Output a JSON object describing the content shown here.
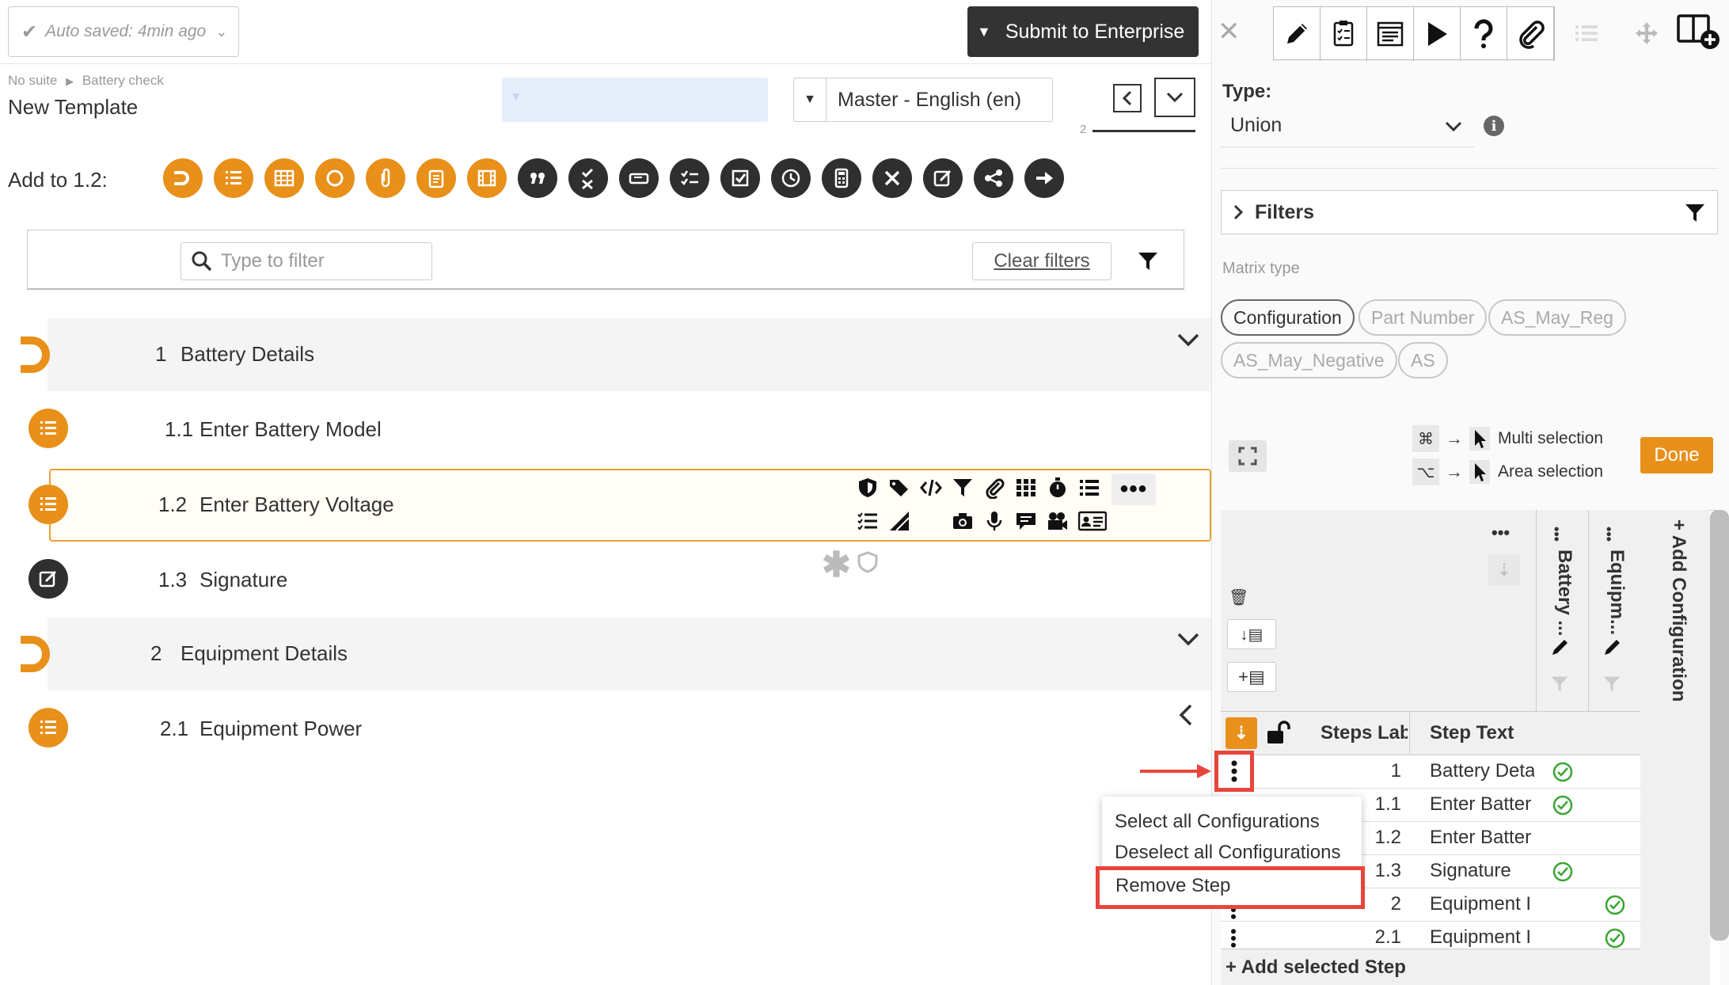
{
  "header": {
    "autosave": "Auto saved: 4min ago",
    "submit": "Submit to Enterprise",
    "breadcrumb_suite": "No suite",
    "breadcrumb_sep": "▶",
    "breadcrumb_item": "Battery check",
    "template_title": "New Template",
    "language": "Master - English (en)",
    "page_counter": "2"
  },
  "add_bar": {
    "label": "Add to 1.2:"
  },
  "filter": {
    "placeholder": "Type to filter",
    "clear": "Clear filters"
  },
  "steps": [
    {
      "num": "1",
      "label": "Battery Details"
    },
    {
      "num": "1.1",
      "label": "Enter Battery Model"
    },
    {
      "num": "1.2",
      "label": "Enter Battery Voltage"
    },
    {
      "num": "1.3",
      "label": "Signature"
    },
    {
      "num": "2",
      "label": "Equipment Details"
    },
    {
      "num": "2.1",
      "label": "Equipment Power"
    }
  ],
  "right": {
    "type_label": "Type:",
    "type_value": "Union",
    "filters": "Filters",
    "matrix_type": "Matrix type",
    "chips": [
      "Configuration",
      "Part Number",
      "AS_May_Reg",
      "AS_May_Negative",
      "AS"
    ],
    "multi_key": "⌘",
    "multi": "Multi selection",
    "area_key": "⌥",
    "area": "Area selection",
    "done": "Done",
    "col1": "Battery ...",
    "col2": "Equipm...",
    "add_config": "+ Add Configuration",
    "grid_head_label": "Steps Lab",
    "grid_head_text": "Step Text",
    "rows": [
      {
        "label": "1",
        "text": "Battery Deta"
      },
      {
        "label": "1.1",
        "text": "Enter Batter"
      },
      {
        "label": "1.2",
        "text": "Enter Batter"
      },
      {
        "label": "1.3",
        "text": "Signature"
      },
      {
        "label": "2",
        "text": "Equipment I"
      },
      {
        "label": "2.1",
        "text": "Equipment I"
      }
    ],
    "add_step": "+ Add selected Step"
  },
  "menu": {
    "items": [
      "Select all Configurations",
      "Deselect all Configurations",
      "Remove Step"
    ]
  },
  "colors": {
    "orange": "#e8901a",
    "dark": "#2f2f2f",
    "green": "#3aa534",
    "red": "#e8453c"
  }
}
